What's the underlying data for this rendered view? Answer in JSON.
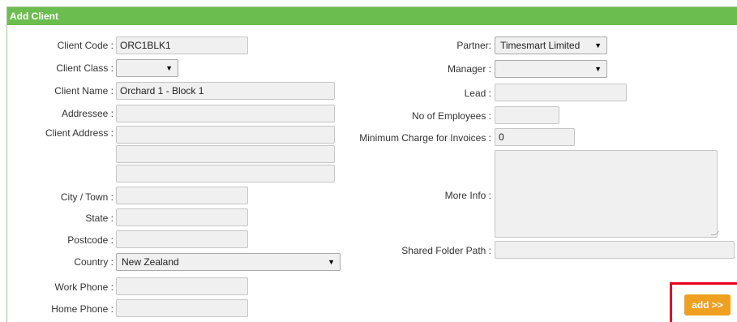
{
  "header": {
    "title": "Add Client"
  },
  "left": {
    "client_code": {
      "label": "Client Code :",
      "value": "ORC1BLK1"
    },
    "client_class": {
      "label": "Client Class :",
      "value": ""
    },
    "client_name": {
      "label": "Client Name :",
      "value": "Orchard 1 - Block 1"
    },
    "addressee": {
      "label": "Addressee :",
      "value": ""
    },
    "client_address": {
      "label": "Client Address :",
      "lines": [
        "",
        "",
        ""
      ]
    },
    "city": {
      "label": "City / Town :",
      "value": ""
    },
    "state": {
      "label": "State :",
      "value": ""
    },
    "postcode": {
      "label": "Postcode :",
      "value": ""
    },
    "country": {
      "label": "Country :",
      "value": "New Zealand"
    },
    "work_phone": {
      "label": "Work Phone :",
      "value": ""
    },
    "home_phone": {
      "label": "Home Phone :",
      "value": ""
    }
  },
  "right": {
    "partner": {
      "label": "Partner:",
      "value": "Timesmart Limited"
    },
    "manager": {
      "label": "Manager :",
      "value": ""
    },
    "lead": {
      "label": "Lead :",
      "value": ""
    },
    "employees": {
      "label": "No of Employees :",
      "value": ""
    },
    "min_charge": {
      "label": "Minimum Charge for Invoices :",
      "value": "0"
    },
    "more_info": {
      "label": "More Info :",
      "value": ""
    },
    "shared_folder": {
      "label": "Shared Folder Path :",
      "value": ""
    }
  },
  "actions": {
    "add_label": "add >>"
  },
  "icons": {
    "dropdown": "caret-down-icon",
    "resize": "resize-grip-icon"
  },
  "colors": {
    "header_bg": "#6bbd4f",
    "add_button": "#f0a020",
    "highlight": "#e8001c"
  }
}
